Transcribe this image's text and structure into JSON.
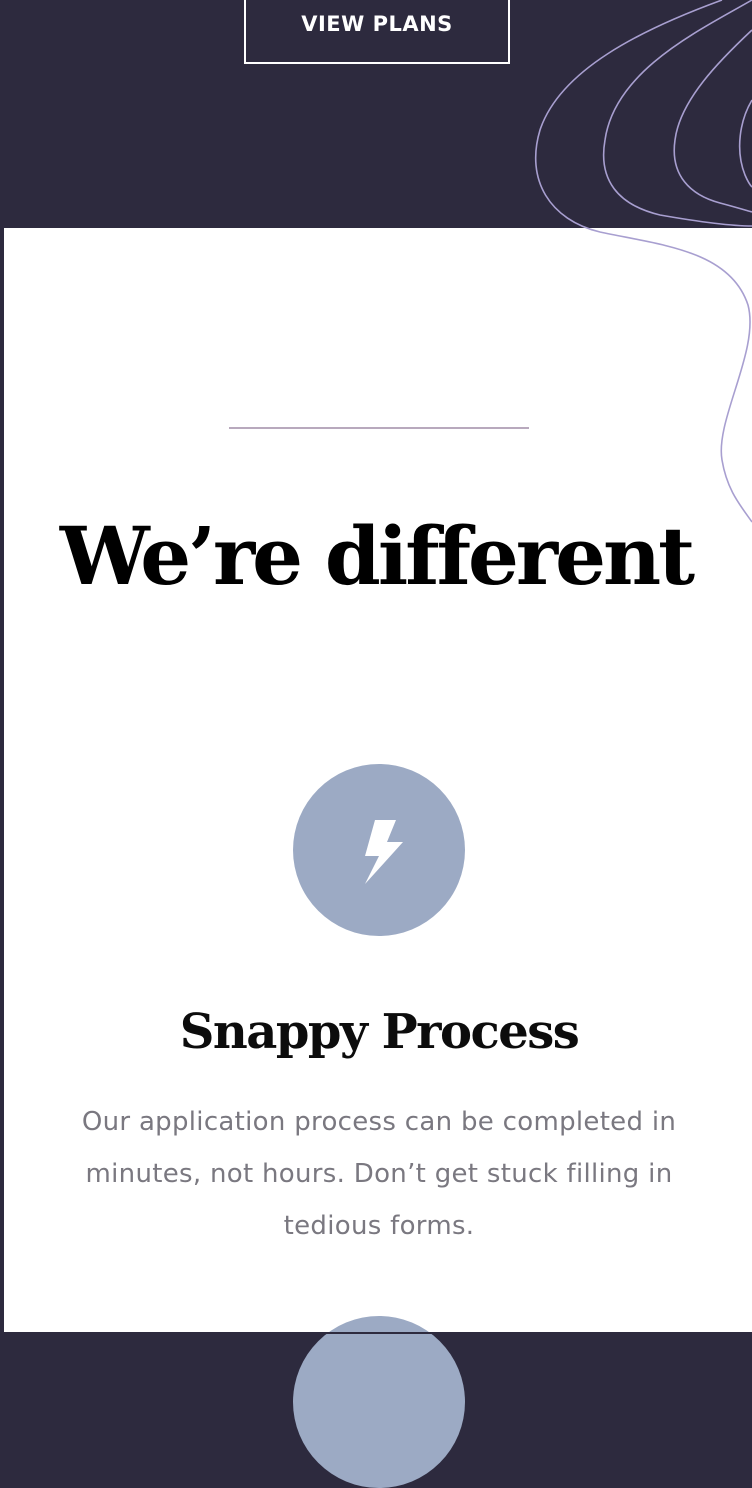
{
  "hero": {
    "cta_label": "VIEW PLANS"
  },
  "section": {
    "title": "We’re different"
  },
  "features": [
    {
      "icon": "lightning-bolt-icon",
      "title": "Snappy Process",
      "description": "Our application process can be completed in minutes, not hours. Don’t get stuck filling in tedious forms."
    }
  ],
  "colors": {
    "hero_background": "#2d2a3e",
    "accent_circle": "#9caac4",
    "divider": "#b8a9bd",
    "wave_line": "#a89fd0",
    "body_text": "#7a7880"
  }
}
